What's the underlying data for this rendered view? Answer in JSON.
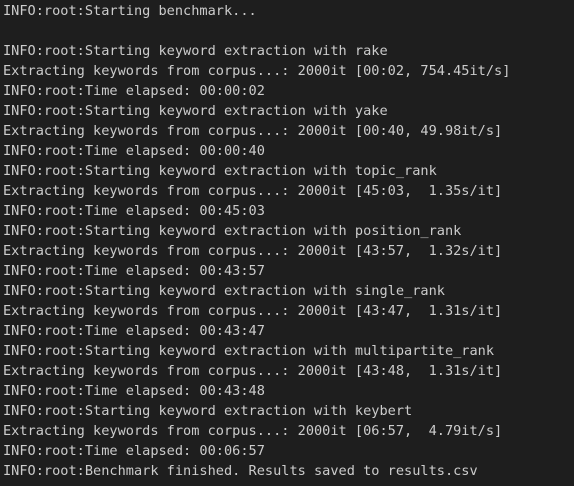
{
  "terminal": {
    "lines": [
      "INFO:root:Starting benchmark...",
      "",
      "INFO:root:Starting keyword extraction with rake",
      "Extracting keywords from corpus...: 2000it [00:02, 754.45it/s]",
      "INFO:root:Time elapsed: 00:00:02",
      "INFO:root:Starting keyword extraction with yake",
      "Extracting keywords from corpus...: 2000it [00:40, 49.98it/s]",
      "INFO:root:Time elapsed: 00:00:40",
      "INFO:root:Starting keyword extraction with topic_rank",
      "Extracting keywords from corpus...: 2000it [45:03,  1.35s/it]",
      "INFO:root:Time elapsed: 00:45:03",
      "INFO:root:Starting keyword extraction with position_rank",
      "Extracting keywords from corpus...: 2000it [43:57,  1.32s/it]",
      "INFO:root:Time elapsed: 00:43:57",
      "INFO:root:Starting keyword extraction with single_rank",
      "Extracting keywords from corpus...: 2000it [43:47,  1.31s/it]",
      "INFO:root:Time elapsed: 00:43:47",
      "INFO:root:Starting keyword extraction with multipartite_rank",
      "Extracting keywords from corpus...: 2000it [43:48,  1.31s/it]",
      "INFO:root:Time elapsed: 00:43:48",
      "INFO:root:Starting keyword extraction with keybert",
      "Extracting keywords from corpus...: 2000it [06:57,  4.79it/s]",
      "INFO:root:Time elapsed: 00:06:57",
      "INFO:root:Benchmark finished. Results saved to results.csv"
    ],
    "colors": {
      "background": "#1e1e1e",
      "text": "#cccccc"
    }
  }
}
